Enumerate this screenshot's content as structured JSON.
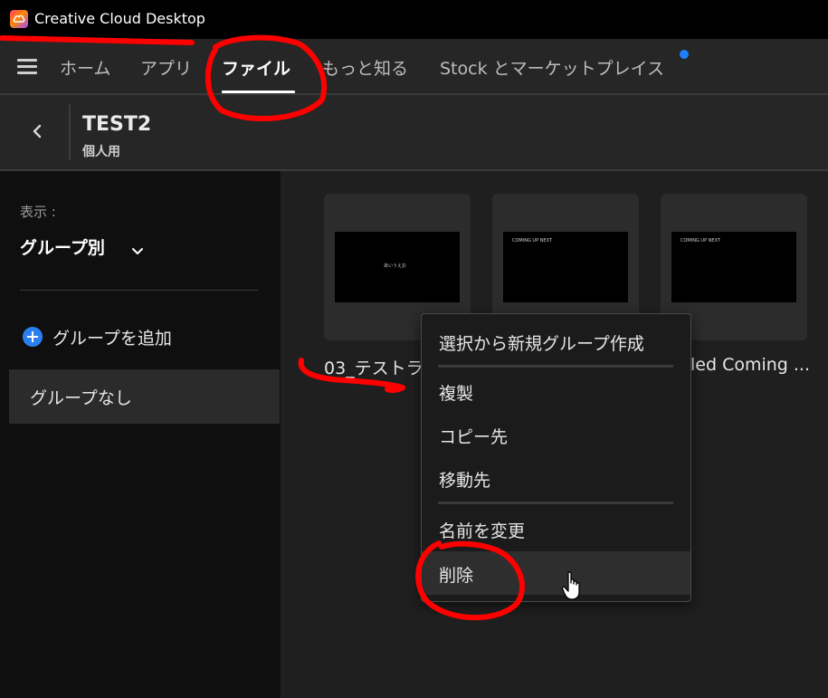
{
  "titlebar": {
    "app_name": "Creative Cloud Desktop",
    "icon": "creative-cloud-logo"
  },
  "nav": {
    "menu_icon": "hamburger-menu-icon",
    "tabs": [
      {
        "label": "ホーム"
      },
      {
        "label": "アプリ"
      },
      {
        "label": "ファイル",
        "active": true
      },
      {
        "label": "もっと知る"
      },
      {
        "label": "Stock とマーケットプレイス",
        "notification": true
      }
    ]
  },
  "folder": {
    "title": "TEST2",
    "subtitle": "個人用"
  },
  "sidebar": {
    "view_label": "表示 :",
    "view_value": "グループ別",
    "add_group_label": "グループを追加",
    "groups": [
      {
        "label": "グループなし",
        "selected": true
      }
    ]
  },
  "files": [
    {
      "name": "03_テストラ",
      "thumb_text": "あいうえお"
    },
    {
      "name": "",
      "thumb_text": "COMING UP NEXT"
    },
    {
      "name": "led Coming ...",
      "thumb_text": "COMING UP NEXT"
    }
  ],
  "context_menu": {
    "items": [
      {
        "label": "選択から新規グループ作成"
      },
      {
        "label": "複製"
      },
      {
        "label": "コピー先"
      },
      {
        "label": "移動先"
      },
      {
        "label": "名前を変更"
      },
      {
        "label": "削除",
        "hovered": true
      }
    ]
  },
  "colors": {
    "accent": "#1e80ff",
    "annotation": "#ff0000",
    "titlebar_bg": "#000000",
    "nav_bg": "#262626",
    "sidebar_bg": "#0f0f0f",
    "main_bg": "#1f1f1f"
  }
}
